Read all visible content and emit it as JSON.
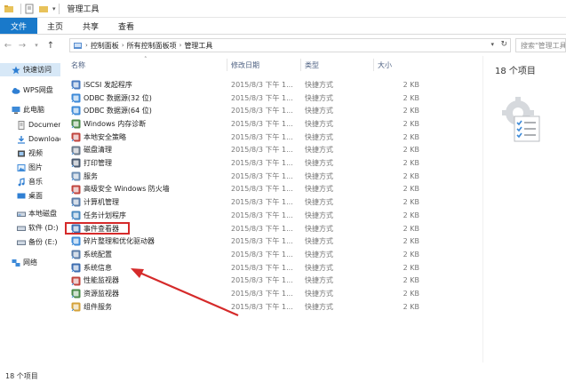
{
  "window": {
    "title": "管理工具"
  },
  "ribbon": {
    "tabs": [
      "文件",
      "主页",
      "共享",
      "查看"
    ]
  },
  "address": {
    "crumbs": [
      "控制面板",
      "所有控制面板项",
      "管理工具"
    ],
    "search_placeholder": "搜索\"管理工具\""
  },
  "nav": {
    "items": [
      {
        "label": "快速访问",
        "icon": "star-icon",
        "selected": true
      },
      {
        "label": "WPS网盘",
        "icon": "cloud-icon"
      },
      {
        "label": "此电脑",
        "icon": "computer-icon"
      },
      {
        "label": "Documents",
        "icon": "document-icon"
      },
      {
        "label": "Downloads",
        "icon": "download-icon"
      },
      {
        "label": "视频",
        "icon": "video-icon"
      },
      {
        "label": "图片",
        "icon": "picture-icon"
      },
      {
        "label": "音乐",
        "icon": "music-icon"
      },
      {
        "label": "桌面",
        "icon": "desktop-icon"
      },
      {
        "label": "本地磁盘",
        "icon": "drive-icon"
      },
      {
        "label": "软件 (D:)",
        "icon": "drive-icon"
      },
      {
        "label": "备份 (E:)",
        "icon": "drive-icon"
      },
      {
        "label": "网络",
        "icon": "network-icon"
      }
    ]
  },
  "columns": {
    "name": "名称",
    "date": "修改日期",
    "type": "类型",
    "size": "大小"
  },
  "files": [
    {
      "name": "iSCSI 发起程序",
      "date": "2015/8/3 下午 1...",
      "type": "快捷方式",
      "size": "2 KB",
      "icon": "iscsi-icon"
    },
    {
      "name": "ODBC 数据源(32 位)",
      "date": "2015/8/3 下午 1...",
      "type": "快捷方式",
      "size": "2 KB",
      "icon": "odbc-icon"
    },
    {
      "name": "ODBC 数据源(64 位)",
      "date": "2015/8/3 下午 1...",
      "type": "快捷方式",
      "size": "2 KB",
      "icon": "odbc-icon"
    },
    {
      "name": "Windows 内存诊断",
      "date": "2015/8/3 下午 1...",
      "type": "快捷方式",
      "size": "2 KB",
      "icon": "memory-icon"
    },
    {
      "name": "本地安全策略",
      "date": "2015/8/3 下午 1...",
      "type": "快捷方式",
      "size": "2 KB",
      "icon": "security-policy-icon"
    },
    {
      "name": "磁盘清理",
      "date": "2015/8/3 下午 1...",
      "type": "快捷方式",
      "size": "2 KB",
      "icon": "disk-cleanup-icon"
    },
    {
      "name": "打印管理",
      "date": "2015/8/3 下午 1...",
      "type": "快捷方式",
      "size": "2 KB",
      "icon": "printer-icon"
    },
    {
      "name": "服务",
      "date": "2015/8/3 下午 1...",
      "type": "快捷方式",
      "size": "2 KB",
      "icon": "services-icon"
    },
    {
      "name": "高级安全 Windows 防火墙",
      "date": "2015/8/3 下午 1...",
      "type": "快捷方式",
      "size": "2 KB",
      "icon": "firewall-icon"
    },
    {
      "name": "计算机管理",
      "date": "2015/8/3 下午 1...",
      "type": "快捷方式",
      "size": "2 KB",
      "icon": "computer-management-icon"
    },
    {
      "name": "任务计划程序",
      "date": "2015/8/3 下午 1...",
      "type": "快捷方式",
      "size": "2 KB",
      "icon": "task-scheduler-icon"
    },
    {
      "name": "事件查看器",
      "date": "2015/8/3 下午 1...",
      "type": "快捷方式",
      "size": "2 KB",
      "icon": "event-viewer-icon"
    },
    {
      "name": "碎片整理和优化驱动器",
      "date": "2015/8/3 下午 1...",
      "type": "快捷方式",
      "size": "2 KB",
      "icon": "defrag-icon"
    },
    {
      "name": "系统配置",
      "date": "2015/8/3 下午 1...",
      "type": "快捷方式",
      "size": "2 KB",
      "icon": "msconfig-icon"
    },
    {
      "name": "系统信息",
      "date": "2015/8/3 下午 1...",
      "type": "快捷方式",
      "size": "2 KB",
      "icon": "system-info-icon"
    },
    {
      "name": "性能监视器",
      "date": "2015/8/3 下午 1...",
      "type": "快捷方式",
      "size": "2 KB",
      "icon": "perfmon-icon"
    },
    {
      "name": "资源监视器",
      "date": "2015/8/3 下午 1...",
      "type": "快捷方式",
      "size": "2 KB",
      "icon": "resmon-icon"
    },
    {
      "name": "组件服务",
      "date": "2015/8/3 下午 1...",
      "type": "快捷方式",
      "size": "2 KB",
      "icon": "component-services-icon"
    }
  ],
  "detail": {
    "count_text": "18 个项目"
  },
  "status": {
    "count_text": "18 个项目"
  },
  "colors": {
    "file_tab": "#1979ca",
    "highlight": "#d52a2a",
    "arrow": "#d52a2a",
    "selection": "#d7e8f7"
  }
}
